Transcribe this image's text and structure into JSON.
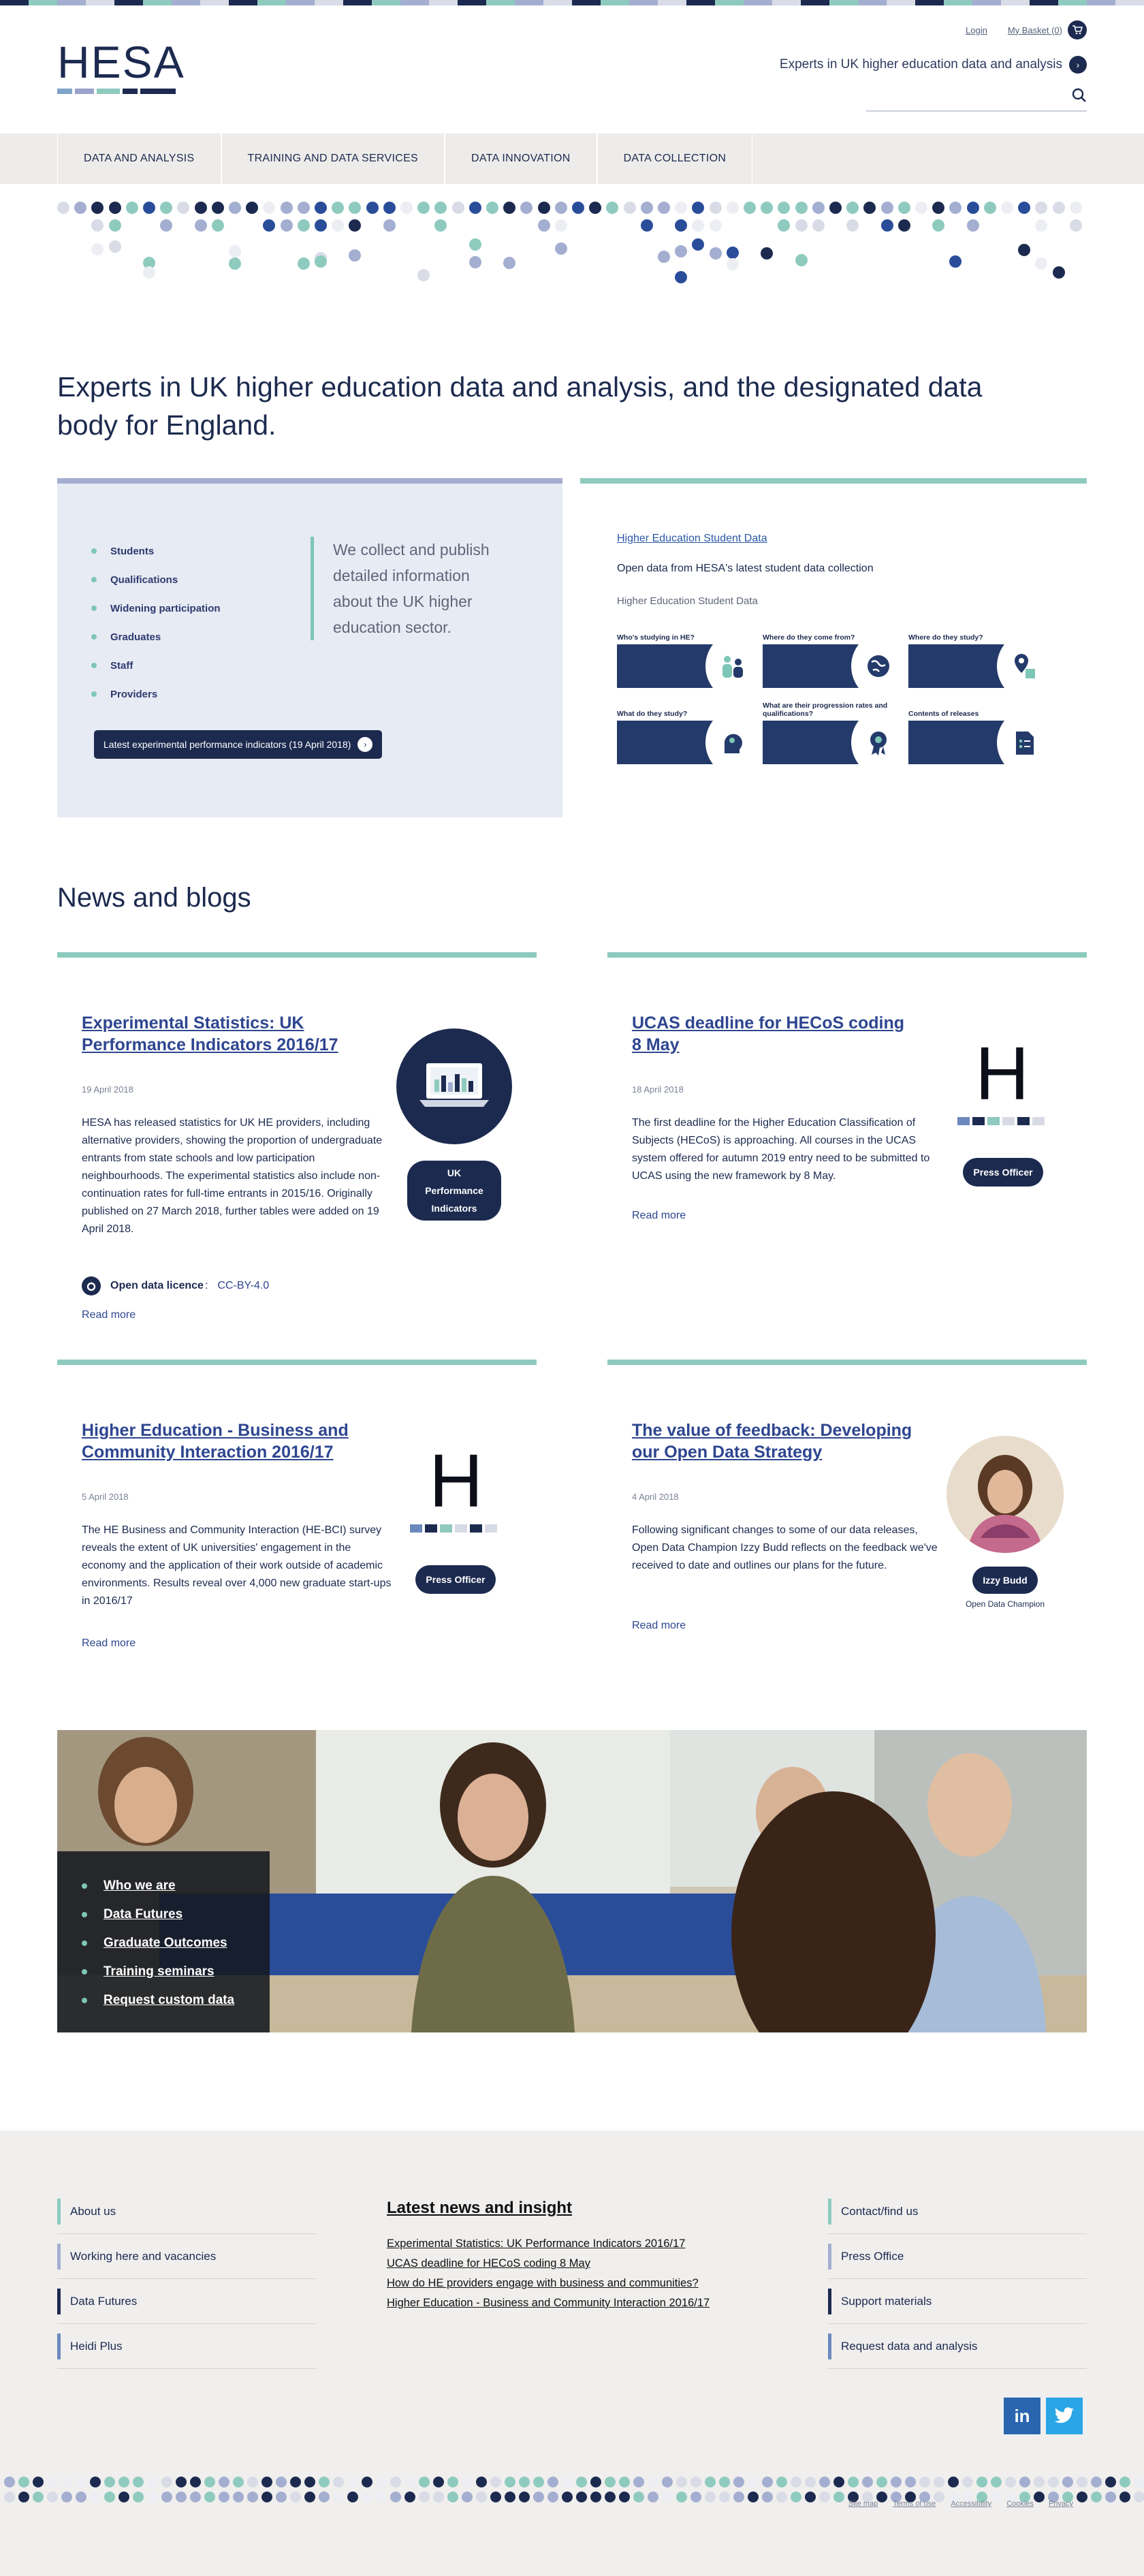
{
  "colors": {
    "navy": "#1c2a4f",
    "teal": "#7ec6b6",
    "lilac": "#a3aed0",
    "link": "#2e4690",
    "panel": "#e7ebf4"
  },
  "header": {
    "logo": "HESA",
    "login": "Login",
    "basket": "My Basket (0)",
    "tagline": "Experts in UK higher education data and analysis",
    "search_placeholder": "",
    "icons": {
      "basket": "cart-icon",
      "tagline": "chevron-right-icon",
      "search": "search-icon"
    }
  },
  "nav": {
    "items": [
      "DATA AND ANALYSIS",
      "TRAINING AND DATA SERVICES",
      "DATA INNOVATION",
      "DATA COLLECTION"
    ]
  },
  "hero": {
    "text": "Experts in UK higher education data and analysis, and the designated data body for England."
  },
  "intro": {
    "topics": [
      "Students",
      "Qualifications",
      "Widening participation",
      "Graduates",
      "Staff",
      "Providers"
    ],
    "quote": "We collect and publish detailed information about the UK higher education sector.",
    "button": "Latest experimental performance indicators (19 April 2018)"
  },
  "student_data": {
    "link": "Higher Education Student Data",
    "subtitle": "Open data from HESA's latest student data collection",
    "label": "Higher Education Student Data",
    "tiles": [
      {
        "caption": "Who's studying in HE?",
        "icon": "people-icon"
      },
      {
        "caption": "Where do they come from?",
        "icon": "globe-icon"
      },
      {
        "caption": "Where do they study?",
        "icon": "location-pin-icon"
      },
      {
        "caption": "What do they study?",
        "icon": "head-icon"
      },
      {
        "caption": "What are their progression rates and qualifications?",
        "icon": "rosette-icon"
      },
      {
        "caption": "Contents of releases",
        "icon": "document-icon"
      }
    ]
  },
  "news": {
    "heading": "News and blogs",
    "read_more": "Read more",
    "items": [
      {
        "title": "Experimental Statistics: UK Performance Indicators 2016/17",
        "date": "19 April 2018",
        "body": "HESA has released statistics for UK HE providers, including alternative providers, showing the proportion of undergraduate entrants from state schools and low participation neighbourhoods. The experimental statistics also include non-continuation rates for full-time entrants in 2015/16. Originally published on 27 March 2018, further tables were added on 19 April 2018.",
        "tag": "UK Performance Indicators",
        "licence_label": "Open data licence",
        "licence": "CC-BY-4.0"
      },
      {
        "title": "UCAS deadline for HECoS coding 8 May",
        "date": "18 April 2018",
        "body": "The first deadline for the Higher Education Classification of Subjects (HECoS) is approaching. All courses in the UCAS system offered for autumn 2019 entry need to be submitted to UCAS using the new framework by 8 May.",
        "tag": "Press Officer",
        "logo": "H"
      },
      {
        "title": "Higher Education - Business and Community Interaction 2016/17",
        "date": "5 April 2018",
        "body": "The HE Business and Community Interaction (HE-BCI) survey reveals the extent of UK universities' engagement in the economy and the application of their work outside of academic environments. Results reveal over 4,000 new graduate start-ups in 2016/17",
        "tag": "Press Officer",
        "logo": "H"
      },
      {
        "title": "The value of feedback: Developing our Open Data Strategy",
        "date": "4 April 2018",
        "body": "Following significant changes to some of our data releases, Open Data Champion Izzy Budd reflects on the feedback we've received to date and outlines our plans for the future.",
        "tag": "Izzy Budd",
        "role": "Open Data Champion"
      }
    ]
  },
  "promo": {
    "links": [
      "Who we are",
      "Data Futures",
      "Graduate Outcomes",
      "Training seminars",
      "Request custom data"
    ]
  },
  "footer": {
    "left": [
      "About us",
      "Working here and vacancies",
      "Data Futures",
      "Heidi Plus"
    ],
    "news_heading": "Latest news and insight",
    "news": [
      "Experimental Statistics: UK Performance Indicators 2016/17",
      "UCAS deadline for HECoS coding 8 May",
      "How do HE providers engage with business and communities?",
      "Higher Education - Business and Community Interaction 2016/17"
    ],
    "right": [
      "Contact/find us",
      "Press Office",
      "Support materials",
      "Request data and analysis"
    ],
    "social": [
      {
        "label": "in",
        "icon": "linkedin-icon"
      },
      {
        "label": "🐦",
        "icon": "twitter-icon"
      }
    ],
    "legal": [
      "Site map",
      "Terms of use",
      "Accessibility",
      "Cookies",
      "Privacy"
    ]
  }
}
